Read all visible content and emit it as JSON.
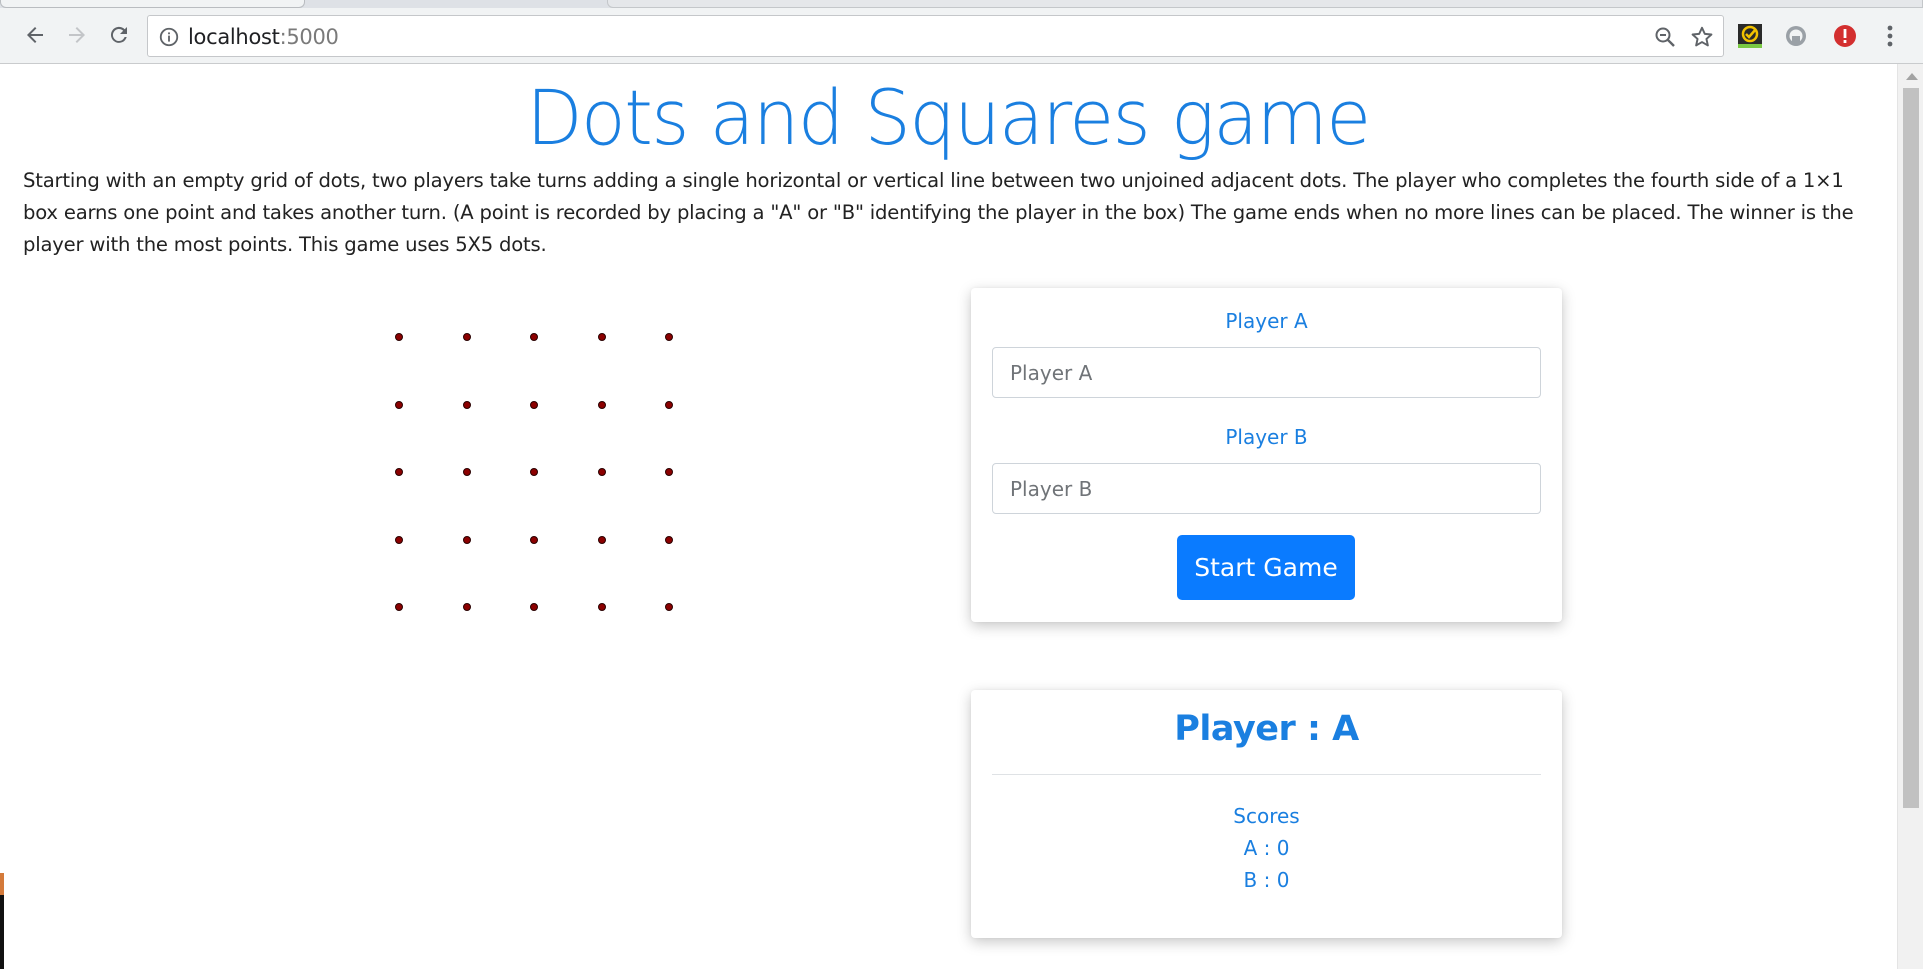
{
  "browser": {
    "url_host": "localhost",
    "url_port": ":5000",
    "icons": [
      "back-icon",
      "forward-icon",
      "reload-icon",
      "info-icon",
      "zoom-icon",
      "star-icon",
      "extension-check-icon",
      "extension-circle-icon",
      "extension-alert-icon",
      "menu-icon"
    ]
  },
  "page": {
    "title": "Dots and Squares game",
    "description": "Starting with an empty grid of dots, two players take turns adding a single horizontal or vertical line between two unjoined adjacent dots. The player who completes the fourth side of a 1×1 box earns one point and takes another turn. (A point is recorded by placing a \"A\" or \"B\" identifying the player in the box) The game ends when no more lines can be placed. The winner is the player with the most points. This game uses 5X5 dots."
  },
  "board": {
    "rows": 5,
    "cols": 5,
    "dot_color": "#8b0000"
  },
  "setup": {
    "player_a_label": "Player A",
    "player_a_placeholder": "Player A",
    "player_a_value": "",
    "player_b_label": "Player B",
    "player_b_placeholder": "Player B",
    "player_b_value": "",
    "start_label": "Start Game"
  },
  "status": {
    "turn_text": "Player : A",
    "scores_label": "Scores",
    "score_a": "A : 0",
    "score_b": "B : 0"
  },
  "colors": {
    "accent": "#1a7fe0",
    "button": "#0a7bff"
  }
}
